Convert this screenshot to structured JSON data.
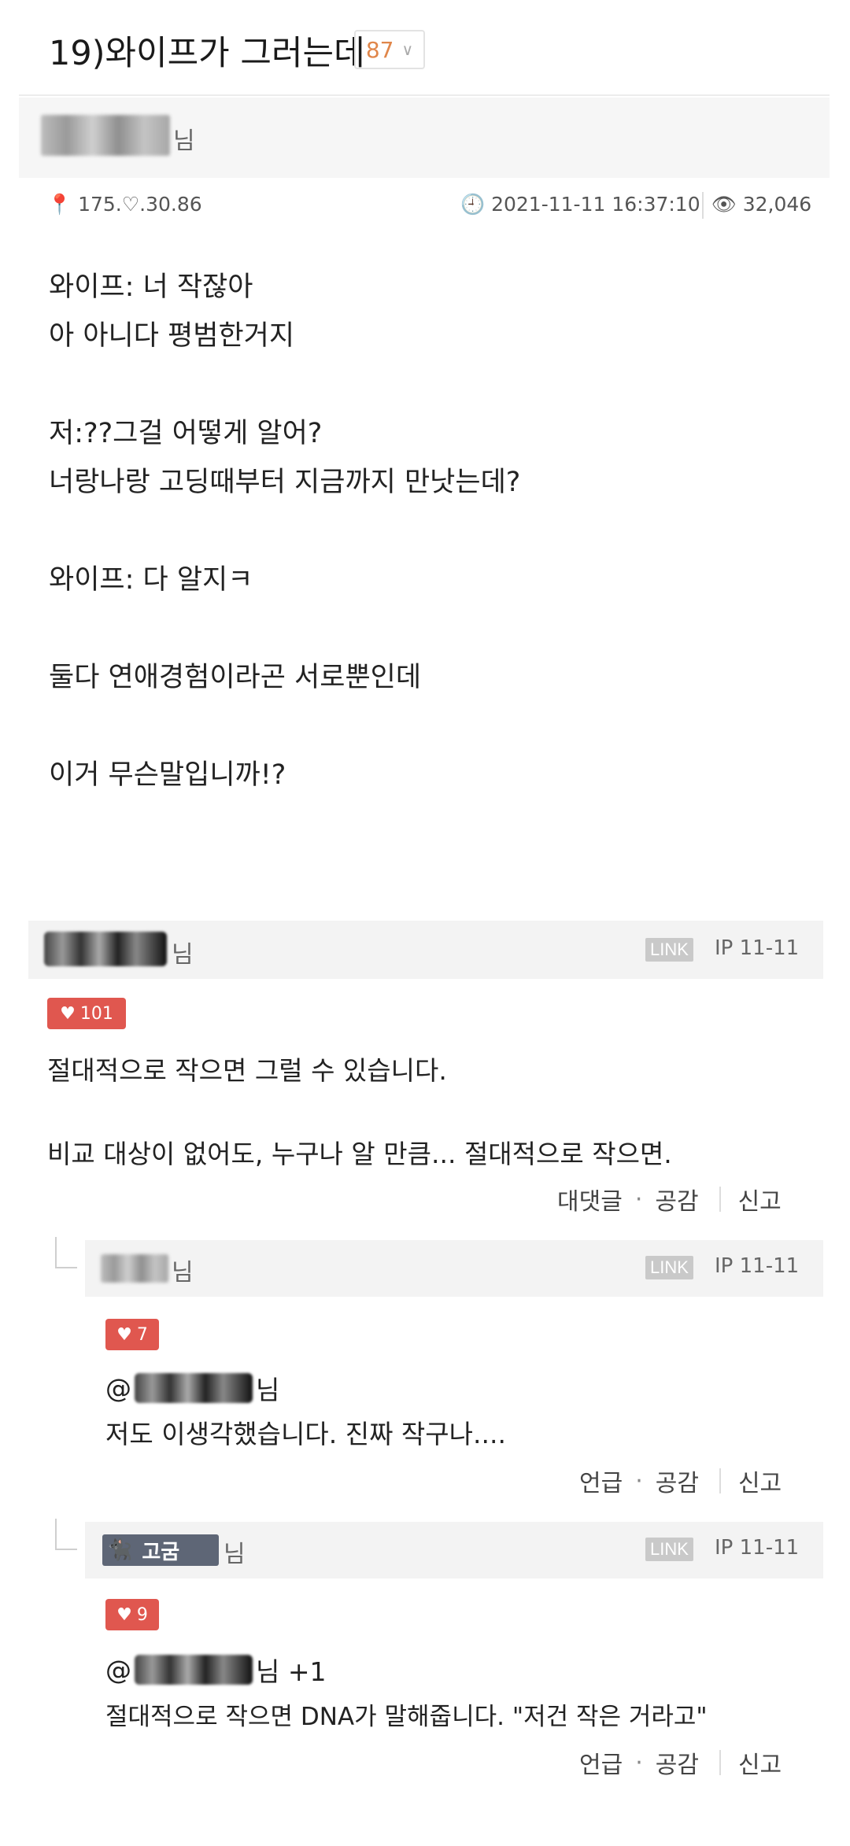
{
  "post": {
    "title": "19)와이프가 그러는데",
    "comment_count": "87",
    "author_suffix": "님",
    "ip": "175.♡.30.86",
    "datetime": "2021-11-11 16:37:10",
    "views": "32,046",
    "lines": [
      "와이프: 너 작잖아",
      "아 아니다 평범한거지",
      "",
      "저:??그걸 어떻게 알어?",
      "너랑나랑 고딩때부터 지금까지 만낫는데?",
      "",
      "와이프: 다 알지ㅋ",
      "",
      "둘다 연애경험이라곤 서로뿐인데",
      "",
      "이거 무슨말입니까!?"
    ]
  },
  "comments": [
    {
      "author_suffix": "님",
      "link": "LINK",
      "ip_date": "IP 11-11",
      "likes": "101",
      "text1": "절대적으로 작으면 그럴 수 있습니다.",
      "text2": "비교 대상이 없어도, 누구나 알 만큼... 절대적으로 작으면.",
      "action1": "대댓글",
      "action2": "공감",
      "action3": "신고"
    },
    {
      "author_suffix": "님",
      "link": "LINK",
      "ip_date": "IP 11-11",
      "likes": "7",
      "mention_prefix": "@",
      "mention_suffix": "님",
      "text": "저도 이생각했습니다. 진짜 작구나....",
      "action1": "언급",
      "action2": "공감",
      "action3": "신고"
    },
    {
      "author": "고굼",
      "author_suffix": "님",
      "link": "LINK",
      "ip_date": "IP 11-11",
      "likes": "9",
      "mention_prefix": "@",
      "mention_suffix": "님 +1",
      "text": "절대적으로 작으면 DNA가 말해줍니다. \"저건 작은 거라고\"",
      "action1": "언급",
      "action2": "공감",
      "action3": "신고"
    }
  ],
  "colors": {
    "like_badge": "#e0574f",
    "count_accent": "#e0864a"
  }
}
